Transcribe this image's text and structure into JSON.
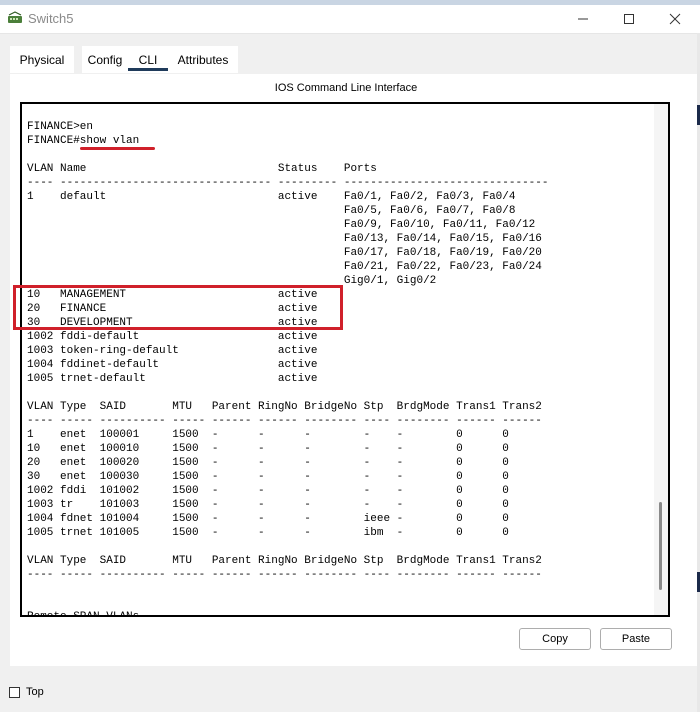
{
  "window": {
    "title": "Switch5",
    "icon": "network-device-icon"
  },
  "window_controls": {
    "minimize": "minimize-icon",
    "maximize": "maximize-icon",
    "close": "close-icon"
  },
  "tabs": [
    {
      "label": "Physical"
    },
    {
      "label": "Config"
    },
    {
      "label": "CLI"
    },
    {
      "label": "Attributes"
    }
  ],
  "active_tab": "CLI",
  "panel": {
    "title": "IOS Command Line Interface"
  },
  "terminal": {
    "lines": [
      "FINANCE>en",
      "FINANCE#show vlan",
      "",
      "VLAN Name                             Status    Ports",
      "---- -------------------------------- --------- -------------------------------",
      "1    default                          active    Fa0/1, Fa0/2, Fa0/3, Fa0/4",
      "                                                Fa0/5, Fa0/6, Fa0/7, Fa0/8",
      "                                                Fa0/9, Fa0/10, Fa0/11, Fa0/12",
      "                                                Fa0/13, Fa0/14, Fa0/15, Fa0/16",
      "                                                Fa0/17, Fa0/18, Fa0/19, Fa0/20",
      "                                                Fa0/21, Fa0/22, Fa0/23, Fa0/24",
      "                                                Gig0/1, Gig0/2",
      "10   MANAGEMENT                       active",
      "20   FINANCE                          active",
      "30   DEVELOPMENT                      active",
      "1002 fddi-default                     active",
      "1003 token-ring-default               active",
      "1004 fddinet-default                  active",
      "1005 trnet-default                    active",
      "",
      "VLAN Type  SAID       MTU   Parent RingNo BridgeNo Stp  BrdgMode Trans1 Trans2",
      "---- ----- ---------- ----- ------ ------ -------- ---- -------- ------ ------",
      "1    enet  100001     1500  -      -      -        -    -        0      0",
      "10   enet  100010     1500  -      -      -        -    -        0      0",
      "20   enet  100020     1500  -      -      -        -    -        0      0",
      "30   enet  100030     1500  -      -      -        -    -        0      0",
      "1002 fddi  101002     1500  -      -      -        -    -        0      0",
      "1003 tr    101003     1500  -      -      -        -    -        0      0",
      "1004 fdnet 101004     1500  -      -      -        ieee -        0      0",
      "1005 trnet 101005     1500  -      -      -        ibm  -        0      0",
      "",
      "VLAN Type  SAID       MTU   Parent RingNo BridgeNo Stp  BrdgMode Trans1 Trans2",
      "---- ----- ---------- ----- ------ ------ -------- ---- -------- ------ ------",
      "",
      "",
      "Remote SPAN VLANs",
      "------------------------------------------------------------------------------"
    ]
  },
  "buttons": {
    "copy": "Copy",
    "paste": "Paste"
  },
  "top_checkbox": {
    "label": "Top",
    "checked": false
  },
  "annotation_color": "#d0202a"
}
